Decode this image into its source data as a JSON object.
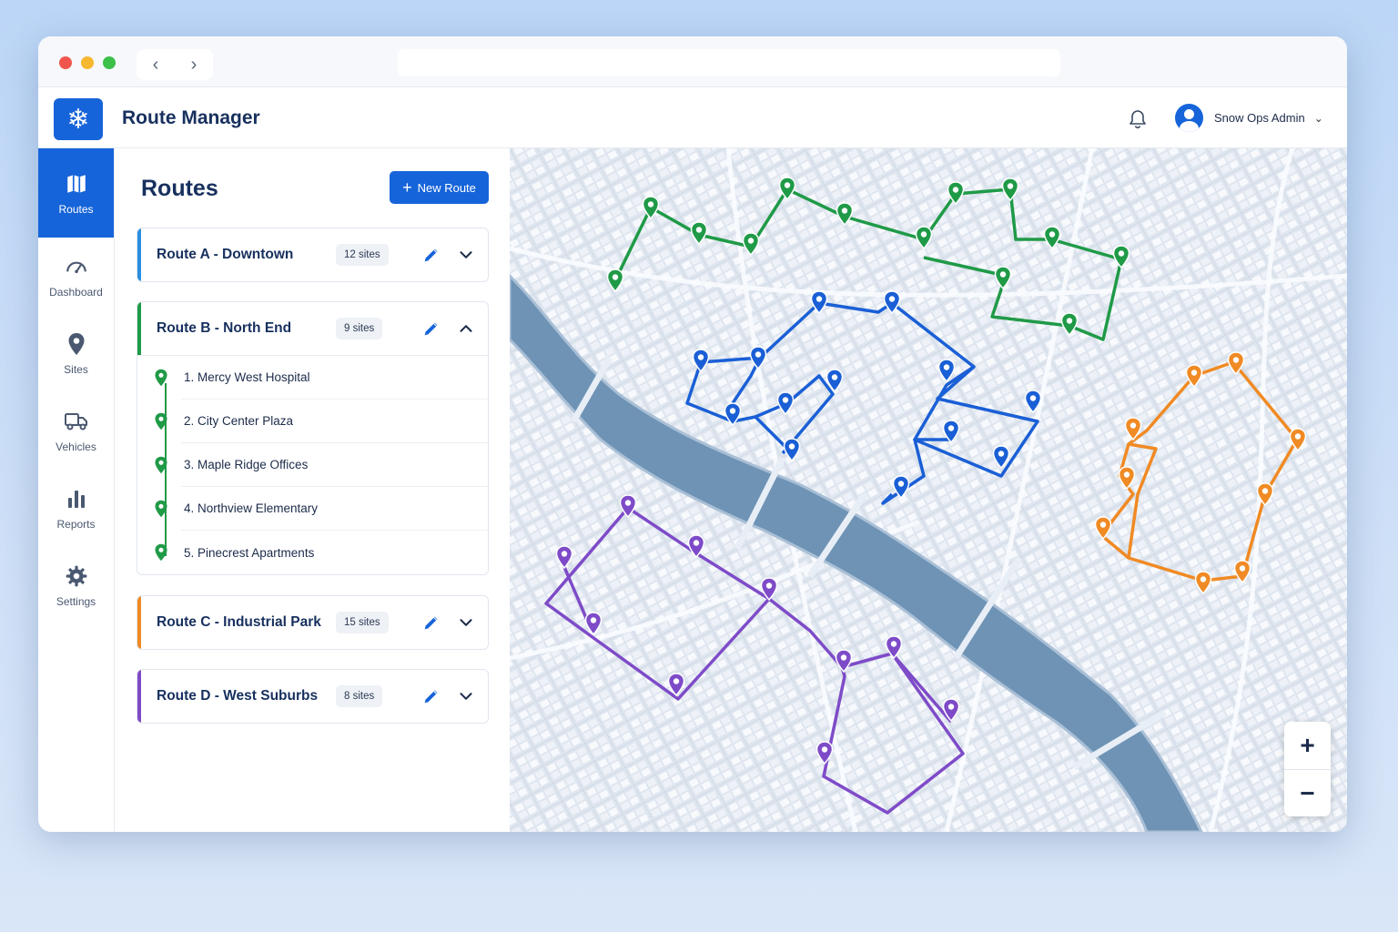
{
  "app": {
    "title": "Route Manager",
    "logo_icon": "snowflake-icon",
    "accent": "#1664d9"
  },
  "browser": {
    "back_icon": "chevron-left-icon",
    "forward_icon": "chevron-right-icon"
  },
  "header": {
    "user_name": "Snow Ops Admin",
    "notification_icon": "bell-icon"
  },
  "sidebar": {
    "items": [
      {
        "label": "Routes",
        "icon": "map-icon",
        "active": true
      },
      {
        "label": "Dashboard",
        "icon": "gauge-icon",
        "active": false
      },
      {
        "label": "Sites",
        "icon": "location-pin-icon",
        "active": false
      },
      {
        "label": "Vehicles",
        "icon": "truck-icon",
        "active": false
      },
      {
        "label": "Reports",
        "icon": "bar-chart-icon",
        "active": false
      },
      {
        "label": "Settings",
        "icon": "gear-icon",
        "active": false
      }
    ]
  },
  "panel": {
    "title": "Routes",
    "new_route_label": "New Route",
    "routes": [
      {
        "name": "Route A - Downtown",
        "sites_badge": "12 sites",
        "color": "#2b8fe0",
        "expanded": false
      },
      {
        "name": "Route B - North End",
        "sites_badge": "9 sites",
        "color": "#1f9a47",
        "expanded": true,
        "sites": [
          "1. Mercy West Hospital",
          "2. City Center Plaza",
          "3. Maple Ridge Offices",
          "4. Northview Elementary",
          "5. Pinecrest Apartments"
        ]
      },
      {
        "name": "Route C - Industrial Park",
        "sites_badge": "15 sites",
        "color": "#f08a24",
        "expanded": false
      },
      {
        "name": "Route D - West Suburbs",
        "sites_badge": "8 sites",
        "color": "#7e4bc8",
        "expanded": false
      }
    ]
  },
  "map": {
    "zoom_in": "+",
    "zoom_out": "−",
    "route_colors": {
      "green": "#1f9a47",
      "blue": "#1a5fd6",
      "orange": "#f08a24",
      "purple": "#7e4bc8"
    }
  }
}
